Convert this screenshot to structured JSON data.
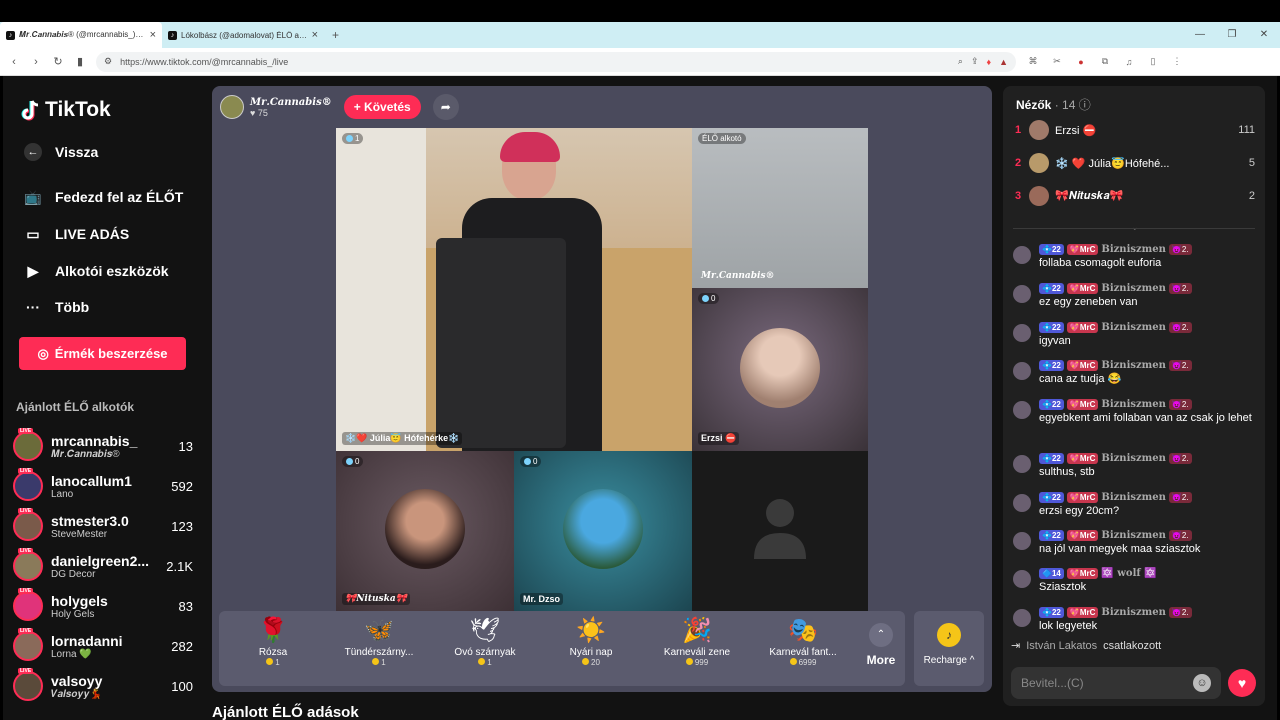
{
  "browser": {
    "tabs": [
      {
        "title": "𝑴𝒓.𝑪𝒂𝒏𝒏𝒂𝒃𝒊𝒔® (@mrcannabis_) ÉLŐ adás",
        "active": true
      },
      {
        "title": "Lókolbász (@adomalovat) ÉLŐ adás",
        "active": false
      }
    ],
    "new_tab": "+",
    "url": "https://www.tiktok.com/@mrcannabis_/live"
  },
  "sidebar": {
    "logo": "TikTok",
    "nav": [
      {
        "label": "Vissza",
        "icon": "back-arrow-icon"
      },
      {
        "label": "Fedezd fel az ÉLŐT",
        "icon": "tv-icon"
      },
      {
        "label": "LIVE ADÁS",
        "icon": "camera-icon"
      },
      {
        "label": "Alkotói eszközök",
        "icon": "play-square-icon"
      },
      {
        "label": "Több",
        "icon": "more-dots-icon"
      }
    ],
    "coins_button": "Érmék beszerzése",
    "recommended_title": "Ajánlott ÉLŐ alkotók",
    "live_badge": "LIVE",
    "creators": [
      {
        "name": "mrcannabis_",
        "sub": "𝑴𝒓.𝑪𝒂𝒏𝒏𝒂𝒃𝒊𝒔®",
        "count": "13",
        "color": "#6b6b3a"
      },
      {
        "name": "lanocallum1",
        "sub": "Lano",
        "count": "592",
        "color": "#3a3a6b"
      },
      {
        "name": "stmester3.0",
        "sub": "SteveMester",
        "count": "123",
        "color": "#7a5a4a"
      },
      {
        "name": "danielgreen2...",
        "sub": "DG Decor",
        "count": "2.1K",
        "color": "#8a7a5a"
      },
      {
        "name": "holygels",
        "sub": "Holy Gels",
        "count": "83",
        "color": "#e0337a"
      },
      {
        "name": "lornadanni",
        "sub": "Lorna 💚",
        "count": "282",
        "color": "#8a6a5a"
      },
      {
        "name": "valsoyy",
        "sub": "𝑽𝒂𝒍𝒔𝒐𝒚𝒚💃",
        "count": "100",
        "color": "#5a4a3a"
      }
    ]
  },
  "stage": {
    "host_name": "𝑴𝒓.𝑪𝒂𝒏𝒏𝒂𝒃𝒊𝒔®",
    "host_likes": "♥ 75",
    "follow_label": "+ Követés",
    "tiles": [
      {
        "badge": "1",
        "name": "❄️❤️ Júlia😇 Hófehérke❄️"
      },
      {
        "badge": "ÉLŐ alkotó",
        "name": "𝑴𝒓.𝑪𝒂𝒏𝒏𝒂𝒃𝒊𝒔®"
      },
      {
        "badge": "0",
        "name": "Erzsi ⛔"
      },
      {
        "badge": "0",
        "name": "🎀𝑵𝒊𝒕𝒖𝒔𝒌𝒂🎀"
      },
      {
        "badge": "0",
        "name": "Mr. Dzso"
      }
    ],
    "gifts": [
      {
        "name": "Rózsa",
        "price": "1",
        "icon": "🌹"
      },
      {
        "name": "Tündérszárny...",
        "price": "1",
        "icon": "🦋"
      },
      {
        "name": "Óvó szárnyak",
        "price": "1",
        "icon": "🕊"
      },
      {
        "name": "Nyári nap",
        "price": "20",
        "icon": "☀️"
      },
      {
        "name": "Karneváli zene",
        "price": "999",
        "icon": "🎉"
      },
      {
        "name": "Karnevál fant...",
        "price": "6999",
        "icon": "🎭"
      }
    ],
    "more_label": "More",
    "recharge_label": "Recharge ^"
  },
  "recommended_lives_title": "Ajánlott ÉLŐ adások",
  "chat": {
    "viewers_label": "Nézők",
    "viewers_count": "· 14",
    "viewers": [
      {
        "rank": "1",
        "name": "Erzsi ⛔",
        "count": "111",
        "color": "#a07a6a"
      },
      {
        "rank": "2",
        "name": "❄️ ❤️ Júlia😇Hófehé...",
        "count": "5",
        "color": "#b89a6a"
      },
      {
        "rank": "3",
        "name": "🎀𝑵𝒊𝒕𝒖𝒔𝒌𝒂🎀",
        "count": "2",
        "color": "#9a6a5a"
      }
    ],
    "messages": [
      {
        "lvl": "💠22",
        "fan": "💖MrC",
        "user": "𝐁𝐢𝐳𝐧𝐢𝐬𝐳𝐦𝐞𝐧",
        "rank": "😈2.",
        "text": "follaba csomagolt euforia"
      },
      {
        "lvl": "💠22",
        "fan": "💖MrC",
        "user": "𝐁𝐢𝐳𝐧𝐢𝐬𝐳𝐦𝐞𝐧",
        "rank": "😈2.",
        "text": "ez egy zeneben van"
      },
      {
        "lvl": "💠22",
        "fan": "💖MrC",
        "user": "𝐁𝐢𝐳𝐧𝐢𝐬𝐳𝐦𝐞𝐧",
        "rank": "😈2.",
        "text": "igyvan"
      },
      {
        "lvl": "💠22",
        "fan": "💖MrC",
        "user": "𝐁𝐢𝐳𝐧𝐢𝐬𝐳𝐦𝐞𝐧",
        "rank": "😈2.",
        "text": "cana az tudja 😂"
      },
      {
        "lvl": "💠22",
        "fan": "💖MrC",
        "user": "𝐁𝐢𝐳𝐧𝐢𝐬𝐳𝐦𝐞𝐧",
        "rank": "😈2.",
        "text": "egyebkent ami follaban van az csak jo lehet"
      },
      {
        "lvl": "💠22",
        "fan": "💖MrC",
        "user": "𝐁𝐢𝐳𝐧𝐢𝐬𝐳𝐦𝐞𝐧",
        "rank": "😈2.",
        "text": "sulthus, stb"
      },
      {
        "lvl": "💠22",
        "fan": "💖MrC",
        "user": "𝐁𝐢𝐳𝐧𝐢𝐬𝐳𝐦𝐞𝐧",
        "rank": "😈2.",
        "text": "erzsi egy 20cm?"
      },
      {
        "lvl": "💠22",
        "fan": "💖MrC",
        "user": "𝐁𝐢𝐳𝐧𝐢𝐬𝐳𝐦𝐞𝐧",
        "rank": "😈2.",
        "text": "na jól van megyek maa sziasztok"
      },
      {
        "lvl": "🔷14",
        "fan": "💖MrC",
        "user": "🔯 wolf 🔯",
        "rank": "",
        "text": "Sziasztok"
      },
      {
        "lvl": "💠22",
        "fan": "💖MrC",
        "user": "𝐁𝐢𝐳𝐧𝐢𝐬𝐳𝐦𝐞𝐧",
        "rank": "😈2.",
        "text": "lok legyetek"
      }
    ],
    "join_name": "István Lakatos",
    "join_text": "csatlakozott",
    "input_placeholder": "Bevitel...(C)"
  }
}
